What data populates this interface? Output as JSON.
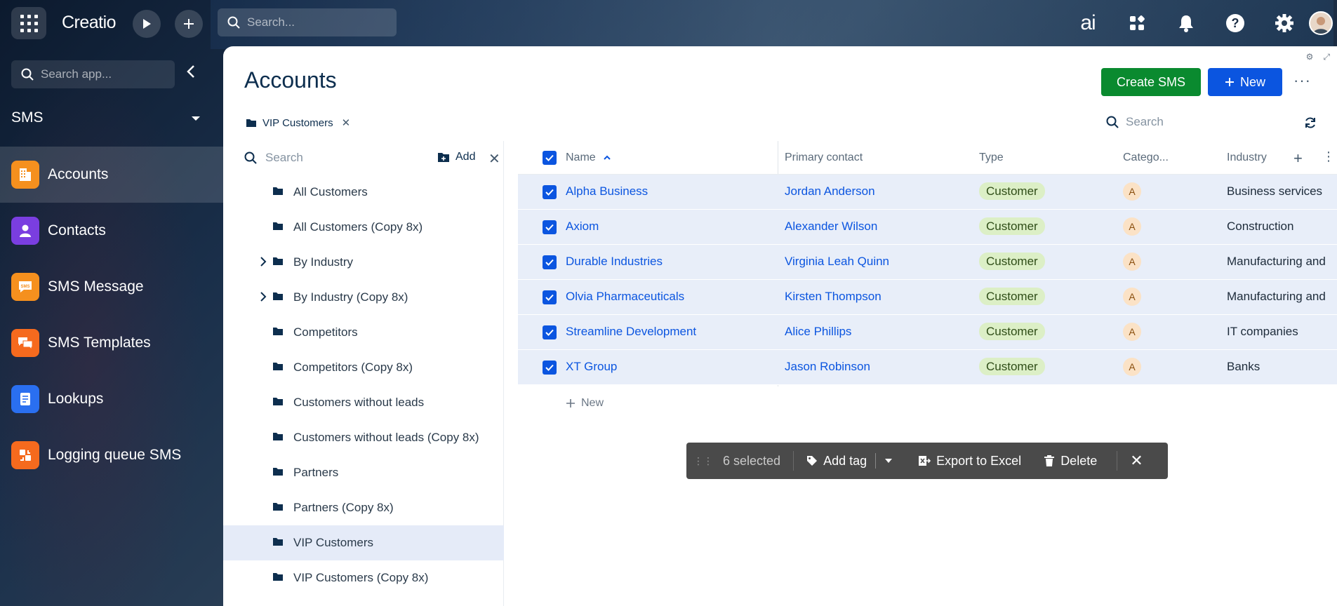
{
  "topbar": {
    "logo": "Creatio",
    "search_placeholder": "Search...",
    "ai_label": "ai"
  },
  "sidebar": {
    "search_placeholder": "Search app...",
    "workspace": "SMS",
    "items": [
      {
        "label": "Accounts",
        "icon": "accounts-icon",
        "color": "#f5901e",
        "active": true
      },
      {
        "label": "Contacts",
        "icon": "contacts-icon",
        "color": "#7a3ee0",
        "active": false
      },
      {
        "label": "SMS Message",
        "icon": "sms-message-icon",
        "color": "#f5901e",
        "active": false
      },
      {
        "label": "SMS Templates",
        "icon": "sms-templates-icon",
        "color": "#f56a1e",
        "active": false
      },
      {
        "label": "Lookups",
        "icon": "lookups-icon",
        "color": "#2a6ff0",
        "active": false
      },
      {
        "label": "Logging queue SMS",
        "icon": "logging-queue-icon",
        "color": "#f56a1e",
        "active": false
      }
    ]
  },
  "page": {
    "title": "Accounts",
    "create_sms_label": "Create SMS",
    "new_label": "New",
    "filter_chip": "VIP Customers",
    "grid_search_placeholder": "Search"
  },
  "folders": {
    "search_placeholder": "Search",
    "add_label": "Add",
    "items": [
      {
        "label": "All Customers",
        "expandable": false,
        "selected": false
      },
      {
        "label": "All Customers (Copy 8x)",
        "expandable": false,
        "selected": false
      },
      {
        "label": "By Industry",
        "expandable": true,
        "selected": false
      },
      {
        "label": "By Industry (Copy 8x)",
        "expandable": true,
        "selected": false
      },
      {
        "label": "Competitors",
        "expandable": false,
        "selected": false
      },
      {
        "label": "Competitors (Copy 8x)",
        "expandable": false,
        "selected": false
      },
      {
        "label": "Customers without leads",
        "expandable": false,
        "selected": false
      },
      {
        "label": "Customers without leads (Copy 8x)",
        "expandable": false,
        "selected": false
      },
      {
        "label": "Partners",
        "expandable": false,
        "selected": false
      },
      {
        "label": "Partners (Copy 8x)",
        "expandable": false,
        "selected": false
      },
      {
        "label": "VIP Customers",
        "expandable": false,
        "selected": true
      },
      {
        "label": "VIP Customers (Copy 8x)",
        "expandable": false,
        "selected": false
      }
    ]
  },
  "grid": {
    "columns": {
      "name": "Name",
      "primary_contact": "Primary contact",
      "type": "Type",
      "category": "Catego...",
      "industry": "Industry"
    },
    "rows": [
      {
        "name": "Alpha Business",
        "contact": "Jordan Anderson",
        "type": "Customer",
        "category": "A",
        "industry": "Business services"
      },
      {
        "name": "Axiom",
        "contact": "Alexander Wilson",
        "type": "Customer",
        "category": "A",
        "industry": "Construction"
      },
      {
        "name": "Durable Industries",
        "contact": "Virginia Leah Quinn",
        "type": "Customer",
        "category": "A",
        "industry": "Manufacturing and"
      },
      {
        "name": "Olvia Pharmaceuticals",
        "contact": "Kirsten Thompson",
        "type": "Customer",
        "category": "A",
        "industry": "Manufacturing and"
      },
      {
        "name": "Streamline Development",
        "contact": "Alice Phillips",
        "type": "Customer",
        "category": "A",
        "industry": "IT companies"
      },
      {
        "name": "XT Group",
        "contact": "Jason Robinson",
        "type": "Customer",
        "category": "A",
        "industry": "Banks"
      }
    ],
    "new_row_label": "New"
  },
  "action_bar": {
    "selected_count": "6 selected",
    "add_tag_label": "Add tag",
    "export_label": "Export to Excel",
    "delete_label": "Delete"
  }
}
